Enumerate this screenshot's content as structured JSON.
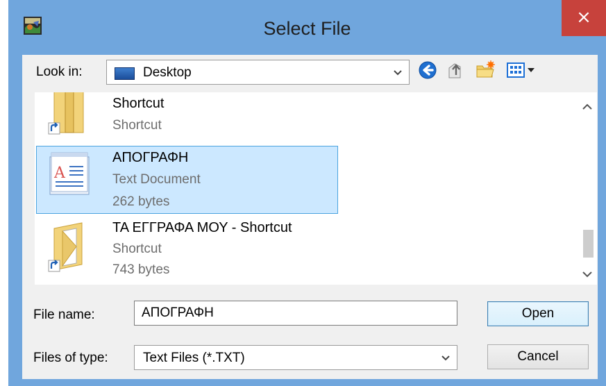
{
  "window": {
    "title": "Select File",
    "close_label": "×"
  },
  "lookin": {
    "label": "Look in:",
    "value": "Desktop"
  },
  "toolbar": {
    "icons": [
      "back-icon",
      "up-folder-icon",
      "new-folder-icon",
      "view-menu-icon"
    ]
  },
  "files": [
    {
      "name": "Shortcut",
      "details": [
        "Shortcut"
      ],
      "icon": "folder-shortcut-icon",
      "selected": false
    },
    {
      "name": "ΑΠΟΓΡΑΦΗ",
      "details": [
        "Text Document",
        "262 bytes"
      ],
      "icon": "text-document-icon",
      "selected": true
    },
    {
      "name": "ΤΑ ΕΓΓΡΑΦΑ ΜΟΥ - Shortcut",
      "details": [
        "Shortcut",
        "743 bytes"
      ],
      "icon": "folder-shortcut-icon",
      "selected": false
    }
  ],
  "filename": {
    "label": "File name:",
    "value": "ΑΠΟΓΡΑΦΗ"
  },
  "filetype": {
    "label": "Files of type:",
    "value": "Text Files (*.TXT)"
  },
  "buttons": {
    "open": "Open",
    "cancel": "Cancel"
  },
  "colors": {
    "title_bar": "#70a6dd",
    "close_button": "#c7423c",
    "selection_fill": "#cce8ff",
    "selection_border": "#4aa3df"
  }
}
